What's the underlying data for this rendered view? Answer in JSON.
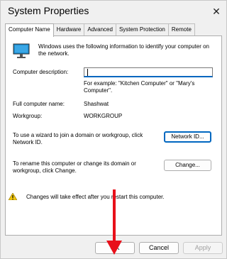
{
  "window": {
    "title": "System Properties",
    "close_glyph": "✕"
  },
  "tabs": [
    {
      "label": "Computer Name",
      "active": true
    },
    {
      "label": "Hardware"
    },
    {
      "label": "Advanced"
    },
    {
      "label": "System Protection"
    },
    {
      "label": "Remote"
    }
  ],
  "panel": {
    "intro": "Windows uses the following information to identify your computer on the network.",
    "description_label": "Computer description:",
    "description_value": "",
    "description_hint": "For example: \"Kitchen Computer\" or \"Mary's Computer\".",
    "full_name_label": "Full computer name:",
    "full_name_value": "Shashwat",
    "workgroup_label": "Workgroup:",
    "workgroup_value": "WORKGROUP",
    "wizard_text": "To use a wizard to join a domain or workgroup, click Network ID.",
    "network_id_button": "Network ID...",
    "rename_text": "To rename this computer or change its domain or workgroup, click Change.",
    "change_button": "Change...",
    "warning_text": "Changes will take effect after you restart this computer."
  },
  "footer": {
    "ok_label": "OK",
    "cancel_label": "Cancel",
    "apply_label": "Apply"
  },
  "colors": {
    "accent": "#0067c0",
    "arrow": "#e8101a",
    "warning": "#f2c811"
  }
}
